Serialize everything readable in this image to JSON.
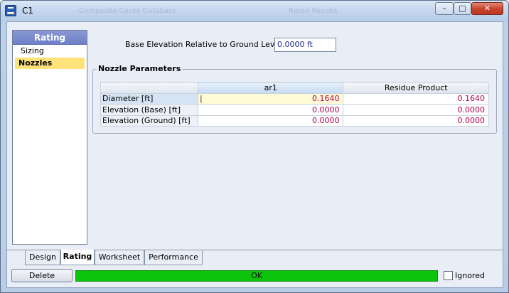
{
  "window": {
    "title": "C1",
    "ghost_text_1": "Composite Cases Database",
    "ghost_text_2": "Rated Results",
    "min_glyph": "–",
    "max_glyph": "□",
    "close_glyph": "✕"
  },
  "left_panel": {
    "header": "Rating",
    "items": [
      {
        "label": "Sizing",
        "selected": false
      },
      {
        "label": "Nozzles",
        "selected": true
      }
    ]
  },
  "base_elevation": {
    "label": "Base Elevation Relative to Ground Level",
    "value": "0.0000 ft"
  },
  "nozzle_group": {
    "title": "Nozzle Parameters",
    "columns": [
      "ar1",
      "Residue Product"
    ],
    "rows": [
      {
        "label": "Diameter [ft]",
        "values": [
          "0.1640",
          "0.1640"
        ]
      },
      {
        "label": "Elevation (Base) [ft]",
        "values": [
          "0.0000",
          "0.0000"
        ]
      },
      {
        "label": "Elevation (Ground) [ft]",
        "values": [
          "0.0000",
          "0.0000"
        ]
      }
    ]
  },
  "tabs": [
    {
      "label": "Design",
      "active": false
    },
    {
      "label": "Rating",
      "active": true
    },
    {
      "label": "Worksheet",
      "active": false
    },
    {
      "label": "Performance",
      "active": false
    }
  ],
  "footer": {
    "delete_label": "Delete",
    "status_text": "OK",
    "status_color": "#0dc40d",
    "ignored_label": "Ignored",
    "ignored_checked": false
  }
}
